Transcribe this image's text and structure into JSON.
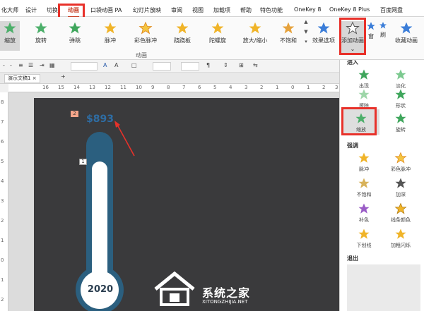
{
  "tabs": [
    "化大师",
    "设计",
    "切换",
    "动画",
    "口袋动画 PA",
    "幻灯片放映",
    "审阅",
    "视图",
    "加载项",
    "帮助",
    "特色功能",
    "OneKey 8",
    "OneKey 8 Plus",
    "百度网盘"
  ],
  "active_tab": "动画",
  "ribbon": {
    "animations": [
      "缩放",
      "旋转",
      "弹跳",
      "脉冲",
      "彩色脉冲",
      "跷跷板",
      "陀螺旋",
      "放大/缩小",
      "不饱和"
    ],
    "selected_animation": "缩放",
    "group_label": "动画",
    "effect_options": "效果选项",
    "add_animation": "添加动画",
    "pane_short": "窗",
    "painter_short": "刷",
    "collect_animation": "收藏动画"
  },
  "doc_tab": {
    "title": "演示文稿1",
    "add": "+"
  },
  "ruler_marks": [
    "16",
    "15",
    "14",
    "13",
    "12",
    "11",
    "10",
    "9",
    "8",
    "7",
    "6",
    "5",
    "4",
    "3",
    "2",
    "1",
    "0",
    "1",
    "2",
    "3"
  ],
  "vruler_marks": [
    "8",
    "7",
    "6",
    "5",
    "4",
    "3",
    "2",
    "1",
    "0",
    "1",
    "2"
  ],
  "slide": {
    "value_text": "$893",
    "year_label": "2020",
    "tag1": "1",
    "tag2": "2"
  },
  "panel": {
    "entrance_header": "进入",
    "entrance": [
      "出现",
      "淡化",
      "擦除",
      "形状",
      "缩放",
      "旋转"
    ],
    "selected": "缩放",
    "emphasis_header": "强调",
    "emphasis": [
      "脉冲",
      "彩色脉冲",
      "不饱和",
      "加深",
      "补色",
      "线条颜色",
      "下划线",
      "加粗闪烁"
    ],
    "exit_header": "退出"
  },
  "watermark": {
    "title": "系统之家",
    "subtitle": "XITONGZHIJIA.NET"
  },
  "colors": {
    "accent": "#c8442a",
    "highlight_box": "#e8312a",
    "slide_bg": "#3a3a3c",
    "thermo_blue": "#2b5f7f",
    "value_blue": "#2e6da4"
  }
}
